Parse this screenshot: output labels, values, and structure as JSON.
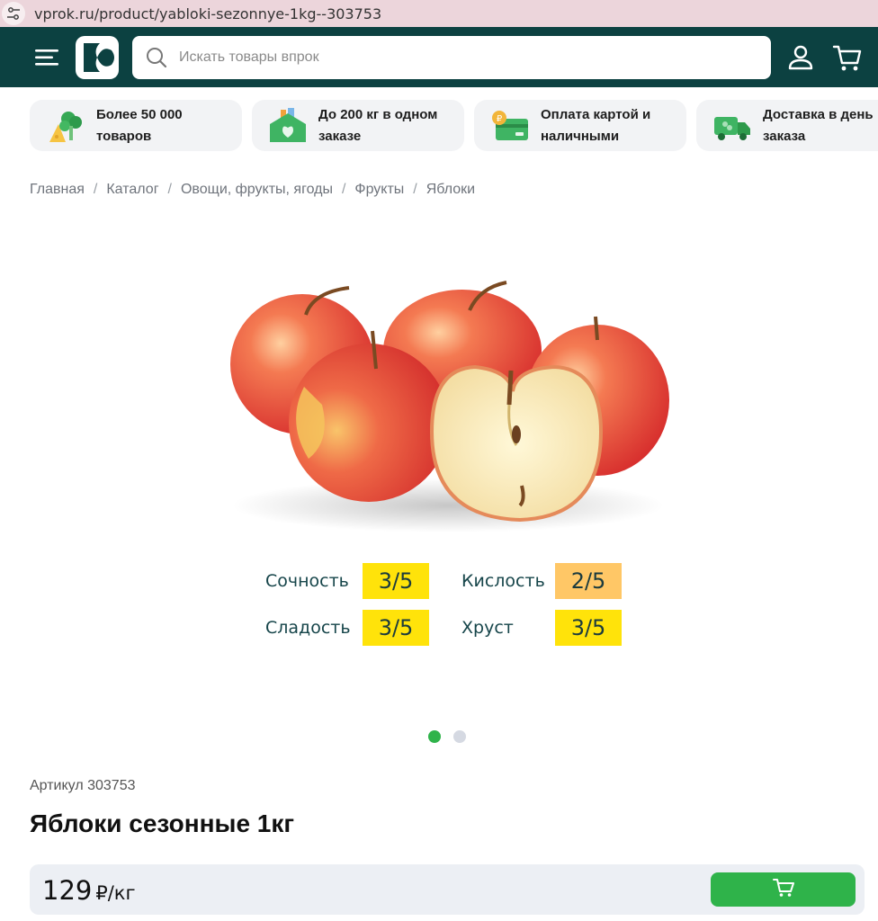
{
  "browser": {
    "url": "vprok.ru/product/yabloki-sezonnye-1kg--303753",
    "site_icon": "tune-icon"
  },
  "header": {
    "menu_icon": "hamburger-icon",
    "logo_icon": "vprok-logo",
    "search_placeholder": "Искать товары впрок",
    "user_icon": "user-icon",
    "cart_icon": "cart-icon"
  },
  "features": [
    {
      "icon": "broccoli-cheese-icon",
      "line1": "Более 50 000",
      "line2": "товаров"
    },
    {
      "icon": "house-groceries-icon",
      "line1": "До 200 кг в одном",
      "line2": "заказе"
    },
    {
      "icon": "card-coin-icon",
      "line1": "Оплата картой и",
      "line2": "наличными"
    },
    {
      "icon": "delivery-truck-icon",
      "line1": "Доставка в день",
      "line2": "заказа"
    }
  ],
  "breadcrumb": [
    "Главная",
    "Катало г",
    "Овощи, фрукты, ягоды",
    "Фрукты",
    "Яблоки"
  ],
  "ratings": [
    {
      "label": "Сочность",
      "value": "3/5",
      "color": "#ffe30a"
    },
    {
      "label": "Кислость",
      "value": "2/5",
      "color": "#ffc766"
    },
    {
      "label": "Сладость",
      "value": "3/5",
      "color": "#ffe30a"
    },
    {
      "label": "Хруст",
      "value": "3/5",
      "color": "#ffe30a"
    }
  ],
  "carousel": {
    "total": 2,
    "active": 1,
    "active_color": "#2fb34a",
    "inactive_color": "#d5d9e2"
  },
  "product": {
    "article": "Артикул 303753",
    "title": "Яблоки сезонные 1кг",
    "price": "129",
    "price_unit": "₽/кг"
  },
  "colors": {
    "header_bg": "#0c4141",
    "accent_green": "#2fb34a"
  }
}
